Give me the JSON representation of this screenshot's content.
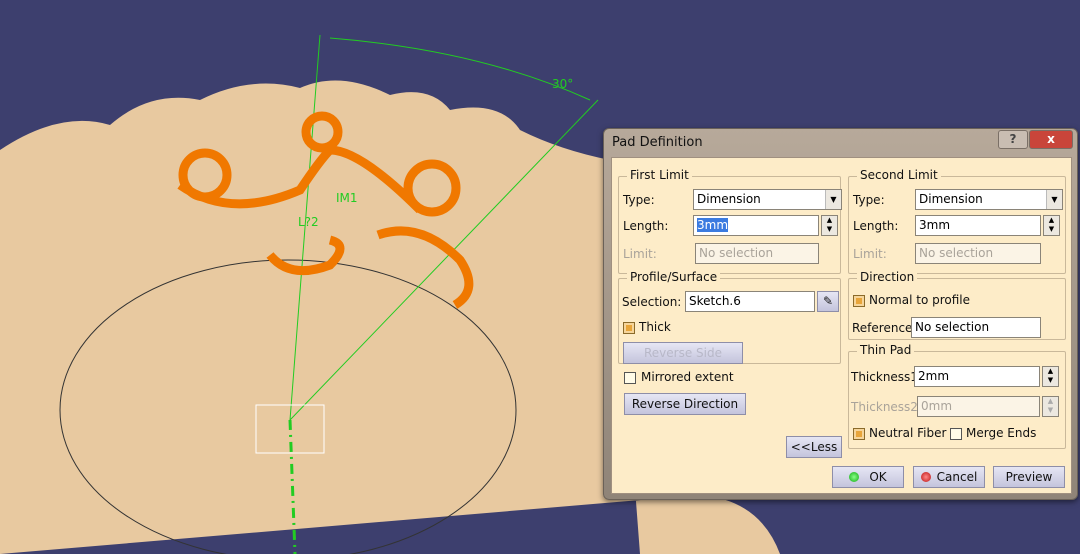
{
  "viewport": {
    "angle_label": "30°",
    "label_a": "IM1",
    "label_b": "L?2",
    "colors": {
      "background": "#3d3f6e",
      "part": "#e8c9a0",
      "sketch": "#22cc22",
      "profile": "#f07800"
    }
  },
  "dialog": {
    "title": "Pad Definition",
    "help": "?",
    "close": "x",
    "first_limit": {
      "title": "First Limit",
      "type_label": "Type:",
      "type_value": "Dimension",
      "length_label": "Length:",
      "length_value": "3mm",
      "limit_label": "Limit:",
      "limit_value": "No selection"
    },
    "second_limit": {
      "title": "Second Limit",
      "type_label": "Type:",
      "type_value": "Dimension",
      "length_label": "Length:",
      "length_value": "3mm",
      "limit_label": "Limit:",
      "limit_value": "No selection"
    },
    "profile": {
      "title": "Profile/Surface",
      "selection_label": "Selection:",
      "selection_value": "Sketch.6",
      "thick_label": "Thick",
      "thick_checked": true,
      "reverse_side": "Reverse Side"
    },
    "mirrored_label": "Mirrored extent",
    "mirrored_checked": false,
    "reverse_direction": "Reverse Direction",
    "less": "<<Less",
    "direction": {
      "title": "Direction",
      "normal_label": "Normal to profile",
      "normal_checked": true,
      "reference_label": "Reference:",
      "reference_value": "No selection"
    },
    "thin_pad": {
      "title": "Thin Pad",
      "thickness1_label": "Thickness1",
      "thickness1_value": "2mm",
      "thickness2_label": "Thickness2:",
      "thickness2_value": "0mm",
      "neutral_label": "Neutral Fiber",
      "neutral_checked": true,
      "merge_label": "Merge Ends",
      "merge_checked": false
    },
    "ok": "OK",
    "cancel": "Cancel",
    "preview": "Preview"
  }
}
